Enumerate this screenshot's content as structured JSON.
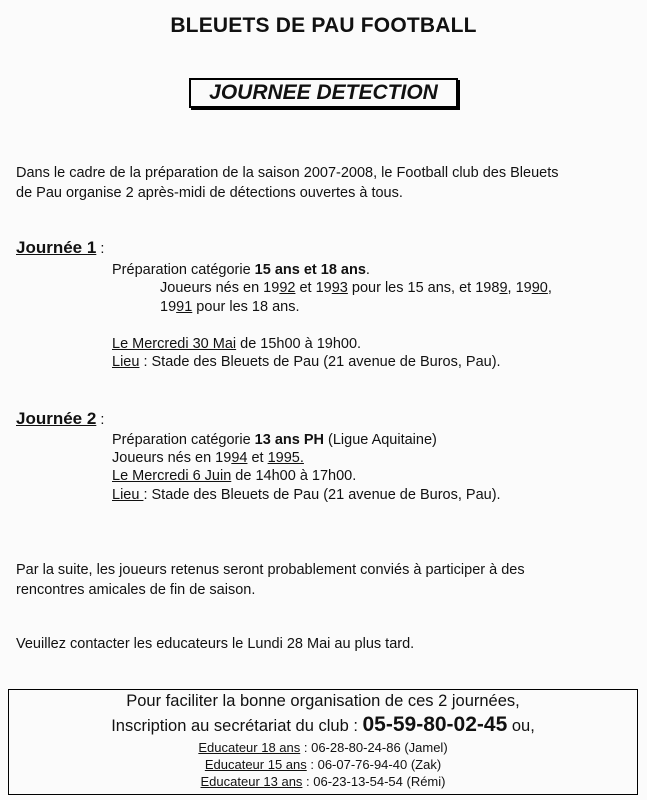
{
  "header": {
    "club": "BLEUETS DE PAU FOOTBALL",
    "event": "JOURNEE DETECTION"
  },
  "intro": {
    "line1": "Dans le cadre de la préparation de la saison 2007-2008, le Football club des Bleuets",
    "line2": "de Pau organise 2 après-midi de détections ouvertes à tous."
  },
  "day1": {
    "title": "Journée 1",
    "colon": " :",
    "prep_prefix": "Préparation catégorie ",
    "prep_bold": "15 ans et 18 ans",
    "prep_suffix": ".",
    "players_a": "Joueurs nés en 19",
    "players_a_u": "92",
    "players_b": " et 19",
    "players_b_u": "93",
    "players_c": " pour les 15 ans, et 198",
    "players_c_u": "9",
    "players_d": ", 19",
    "players_d_u": "90",
    "players_e": ",",
    "players2_a": "19",
    "players2_a_u": "91",
    "players2_b": " pour les 18 ans.",
    "date": "Le Mercredi 30 Mai",
    "time": " de 15h00 à 19h00.",
    "place_label": "Lieu",
    "place": " : Stade des Bleuets de Pau (21 avenue de Buros, Pau)."
  },
  "day2": {
    "title": "Journée 2",
    "colon": " :",
    "prep_prefix": "Préparation catégorie ",
    "prep_bold": "13 ans PH",
    "prep_suffix": " (Ligue Aquitaine)",
    "players_a": "Joueurs nés en 19",
    "players_a_u": "94",
    "players_b": " et ",
    "players_b_u": "1995.",
    "date": "Le Mercredi 6 Juin",
    "time": " de 14h00 à 17h00.",
    "place_label": "Lieu ",
    "place": ": Stade des Bleuets de Pau (21 avenue de Buros, Pau)."
  },
  "outro": {
    "line1": "Par la suite, les joueurs retenus seront probablement conviés à participer à des",
    "line2": "rencontres amicales de fin de saison.",
    "contact": "Veuillez contacter les educateurs le Lundi 28 Mai au plus tard."
  },
  "footer": {
    "line1": "Pour faciliter la bonne organisation de ces 2 journées,",
    "line2_prefix": "Inscription au secrétariat du club : ",
    "phone": "05-59-80-02-45",
    "line2_suffix": " ou,",
    "educators": [
      {
        "label": "Educateur 18 ans",
        "contact": " : 06-28-80-24-86 (Jamel)"
      },
      {
        "label": "Educateur 15 ans",
        "contact": " : 06-07-76-94-40 (Zak)"
      },
      {
        "label": "Educateur 13 ans",
        "contact": " : 06-23-13-54-54 (Rémi)"
      }
    ]
  }
}
